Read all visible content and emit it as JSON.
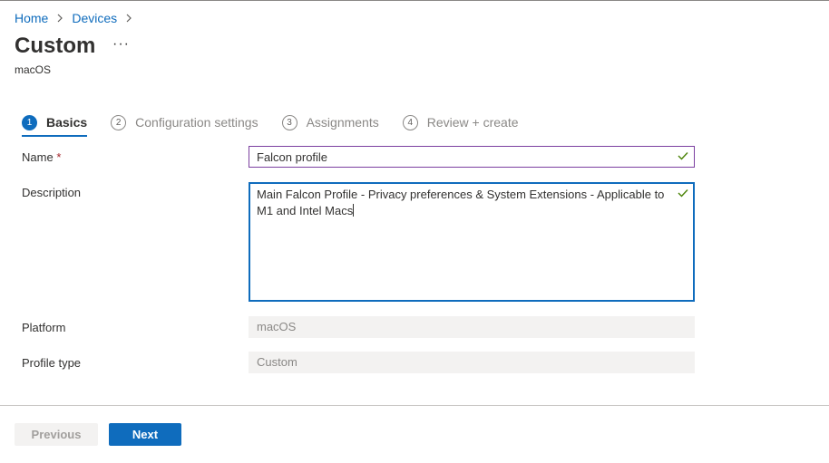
{
  "breadcrumb": {
    "home": "Home",
    "devices": "Devices"
  },
  "header": {
    "title": "Custom",
    "more": "···",
    "subtitle": "macOS"
  },
  "wizard": {
    "steps": [
      {
        "number": "1",
        "label": "Basics",
        "active": true
      },
      {
        "number": "2",
        "label": "Configuration settings",
        "active": false
      },
      {
        "number": "3",
        "label": "Assignments",
        "active": false
      },
      {
        "number": "4",
        "label": "Review + create",
        "active": false
      }
    ]
  },
  "form": {
    "name_label": "Name",
    "required_marker": "*",
    "name_value": "Falcon profile",
    "description_label": "Description",
    "description_value": "Main Falcon Profile - Privacy preferences & System Extensions - Applicable to M1 and Intel Macs",
    "platform_label": "Platform",
    "platform_value": "macOS",
    "profile_type_label": "Profile type",
    "profile_type_value": "Custom"
  },
  "footer": {
    "previous_label": "Previous",
    "next_label": "Next"
  },
  "colors": {
    "accent": "#0f6cbd",
    "valid_check": "#498205",
    "required": "#a4262c"
  },
  "icons": {
    "valid": "checkmark-icon",
    "separator": "chevron-right-icon"
  }
}
